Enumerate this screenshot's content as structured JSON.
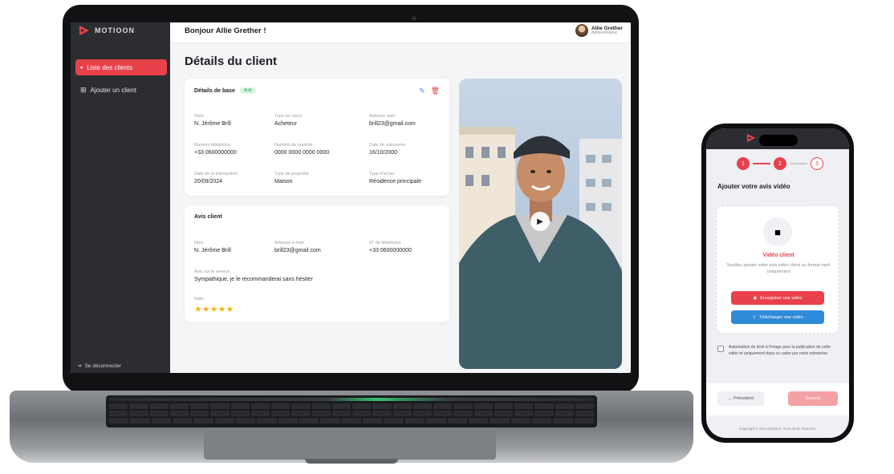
{
  "app": {
    "brand_name": "MOTIOON",
    "accent_color": "#e8414b",
    "sidebar_color": "#2b2d31"
  },
  "sidebar": {
    "items": [
      {
        "label": "Liste des clients",
        "icon": "folder-icon",
        "active": true
      },
      {
        "label": "Ajouter un client",
        "icon": "user-plus-icon",
        "active": false
      }
    ],
    "logout_label": "Se déconnecter"
  },
  "topbar": {
    "greeting": "Bonjour Allie Grether !",
    "user_name": "Allie Grether",
    "user_role": "Administrateur"
  },
  "main": {
    "title": "Détails du client",
    "basic_card": {
      "title": "Détails de base",
      "badge": "Actif",
      "fields": [
        {
          "label": "Nom",
          "value": "N. Jérôme Brill"
        },
        {
          "label": "Type de client",
          "value": "Acheteur"
        },
        {
          "label": "Adresse mail",
          "value": "brill23@gmail.com"
        },
        {
          "label": "Numéro téléphone",
          "value": "+33 0600000000"
        },
        {
          "label": "Numéro de mandat",
          "value": "0000 0000 0000 0000"
        },
        {
          "label": "Date de naissance",
          "value": "16/10/2000"
        },
        {
          "label": "Date de la transaction",
          "value": "20/09/2024"
        },
        {
          "label": "Type de propriété",
          "value": "Maison"
        },
        {
          "label": "Type d'achat",
          "value": "Résidence principale"
        }
      ]
    },
    "review_card": {
      "title": "Avis client",
      "fields": [
        {
          "label": "Nom",
          "value": "N. Jérôme Brill"
        },
        {
          "label": "Adresse e-mail",
          "value": "brill23@gmail.com"
        },
        {
          "label": "N° de téléphone",
          "value": "+33 0600000000"
        }
      ],
      "comment_label": "Avis sur le service",
      "comment": "Sympathique, je le recommanderai sans hésiter",
      "rating_label": "Note",
      "rating": 5,
      "stars": "★★★★★"
    },
    "video": {
      "play_icon": "play-icon"
    }
  },
  "phone": {
    "steps": [
      "1",
      "2",
      "3"
    ],
    "title": "Ajouter votre avis vidéo",
    "upload": {
      "icon": "video-camera-icon",
      "label": "Vidéo client",
      "description": "Veuillez ajouter votre avis vidéo client au format mp4 uniquement",
      "record_label": "Enregistrer une vidéo",
      "upload_label": "Télécharger une vidéo"
    },
    "consent_text": "Autorisation du droit à l'image pour la publication de cette vidéo et uniquement dans ce cadre par notre entreprise.",
    "prev_label": "← Précédent",
    "next_label": "Suivant",
    "copyright": "Copyright © 2024 Motioon. Tous droits réservés."
  }
}
